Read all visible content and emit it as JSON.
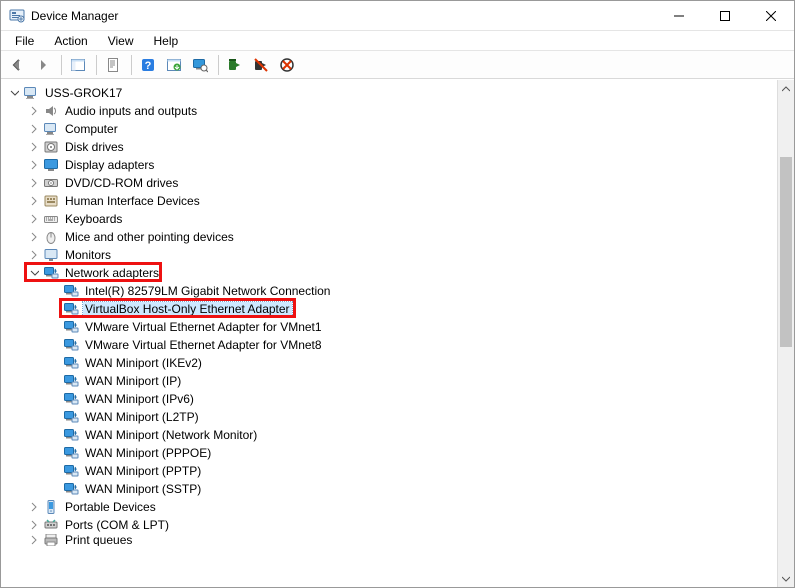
{
  "window": {
    "title": "Device Manager"
  },
  "menu": {
    "items": [
      "File",
      "Action",
      "View",
      "Help"
    ]
  },
  "toolbar": {
    "buttons": [
      {
        "name": "back-button",
        "icon": "arrow-left"
      },
      {
        "name": "forward-button",
        "icon": "arrow-right"
      },
      {
        "sep": true
      },
      {
        "name": "show-hide-tree-button",
        "icon": "panel"
      },
      {
        "sep": true
      },
      {
        "name": "properties-button",
        "icon": "sheet"
      },
      {
        "sep": true
      },
      {
        "name": "help-button",
        "icon": "help"
      },
      {
        "name": "update-driver-button",
        "icon": "update"
      },
      {
        "name": "scan-hardware-button",
        "icon": "monitor"
      },
      {
        "sep": true
      },
      {
        "name": "enable-device-button",
        "icon": "enable"
      },
      {
        "name": "disable-device-button",
        "icon": "disable"
      },
      {
        "name": "uninstall-device-button",
        "icon": "uninstall"
      }
    ]
  },
  "tree": {
    "root": {
      "label": "USS-GROK17",
      "expanded": true,
      "icon": "computer"
    },
    "categories": [
      {
        "label": "Audio inputs and outputs",
        "icon": "audio",
        "expanded": false
      },
      {
        "label": "Computer",
        "icon": "computer",
        "expanded": false
      },
      {
        "label": "Disk drives",
        "icon": "disk",
        "expanded": false
      },
      {
        "label": "Display adapters",
        "icon": "display",
        "expanded": false
      },
      {
        "label": "DVD/CD-ROM drives",
        "icon": "cdrom",
        "expanded": false
      },
      {
        "label": "Human Interface Devices",
        "icon": "hid",
        "expanded": false
      },
      {
        "label": "Keyboards",
        "icon": "keyboard",
        "expanded": false
      },
      {
        "label": "Mice and other pointing devices",
        "icon": "mouse",
        "expanded": false
      },
      {
        "label": "Monitors",
        "icon": "monitor",
        "expanded": false
      },
      {
        "label": "Network adapters",
        "icon": "network",
        "expanded": true,
        "highlighted": true,
        "children": [
          {
            "label": "Intel(R) 82579LM Gigabit Network Connection",
            "icon": "network"
          },
          {
            "label": "VirtualBox Host-Only Ethernet Adapter",
            "icon": "network",
            "selected": true,
            "highlighted": true
          },
          {
            "label": "VMware Virtual Ethernet Adapter for VMnet1",
            "icon": "network"
          },
          {
            "label": "VMware Virtual Ethernet Adapter for VMnet8",
            "icon": "network"
          },
          {
            "label": "WAN Miniport (IKEv2)",
            "icon": "network"
          },
          {
            "label": "WAN Miniport (IP)",
            "icon": "network"
          },
          {
            "label": "WAN Miniport (IPv6)",
            "icon": "network"
          },
          {
            "label": "WAN Miniport (L2TP)",
            "icon": "network"
          },
          {
            "label": "WAN Miniport (Network Monitor)",
            "icon": "network"
          },
          {
            "label": "WAN Miniport (PPPOE)",
            "icon": "network"
          },
          {
            "label": "WAN Miniport (PPTP)",
            "icon": "network"
          },
          {
            "label": "WAN Miniport (SSTP)",
            "icon": "network"
          }
        ]
      },
      {
        "label": "Portable Devices",
        "icon": "portable",
        "expanded": false
      },
      {
        "label": "Ports (COM & LPT)",
        "icon": "ports",
        "expanded": false
      },
      {
        "label": "Print queues",
        "icon": "printer",
        "expanded": false,
        "clipped": true
      }
    ]
  }
}
